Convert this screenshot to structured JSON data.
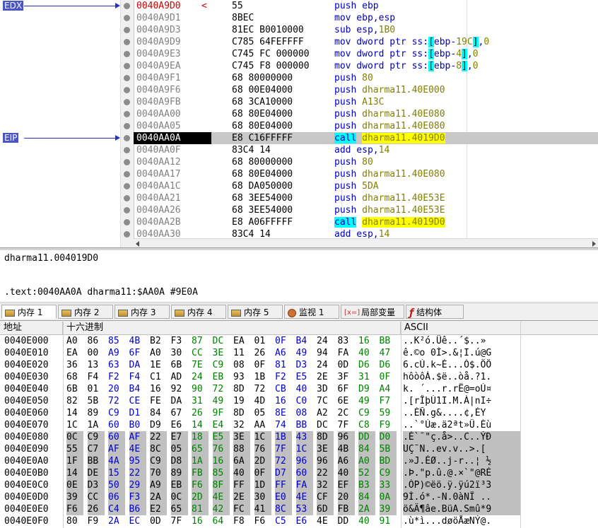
{
  "registers": [
    {
      "name": "EDX",
      "row": 0
    },
    {
      "name": "EIP",
      "row": 11
    }
  ],
  "disasm": {
    "rows": [
      {
        "addr": "0040A9D0",
        "mark": "<",
        "bytes": "55",
        "parts": [
          [
            "mn",
            "push "
          ],
          [
            "op",
            "ebp"
          ]
        ]
      },
      {
        "addr": "0040A9D1",
        "mark": "",
        "bytes": "8BEC",
        "parts": [
          [
            "op",
            "mov ebp,esp"
          ]
        ]
      },
      {
        "addr": "0040A9D3",
        "mark": "",
        "bytes": "81EC B0010000",
        "parts": [
          [
            "op",
            "sub esp,"
          ],
          [
            "num",
            "1B0"
          ]
        ]
      },
      {
        "addr": "0040A9D9",
        "mark": "",
        "bytes": "C785 64FEFFFF",
        "parts": [
          [
            "op",
            "mov dword ptr "
          ],
          [
            "seg",
            "ss:"
          ],
          [
            "br",
            "["
          ],
          [
            "op",
            "ebp-"
          ],
          [
            "num",
            "19C"
          ],
          [
            "br",
            "]"
          ],
          [
            "op",
            ","
          ],
          [
            "num",
            "0"
          ]
        ]
      },
      {
        "addr": "0040A9E3",
        "mark": "",
        "bytes": "C745 FC 000000",
        "parts": [
          [
            "op",
            "mov dword ptr "
          ],
          [
            "seg",
            "ss:"
          ],
          [
            "br",
            "["
          ],
          [
            "op",
            "ebp-"
          ],
          [
            "num",
            "4"
          ],
          [
            "br",
            "]"
          ],
          [
            "op",
            ","
          ],
          [
            "num",
            "0"
          ]
        ]
      },
      {
        "addr": "0040A9EA",
        "mark": "",
        "bytes": "C745 F8 000000",
        "parts": [
          [
            "op",
            "mov dword ptr "
          ],
          [
            "seg",
            "ss:"
          ],
          [
            "br",
            "["
          ],
          [
            "op",
            "ebp-"
          ],
          [
            "num",
            "8"
          ],
          [
            "br",
            "]"
          ],
          [
            "op",
            ","
          ],
          [
            "num",
            "0"
          ]
        ]
      },
      {
        "addr": "0040A9F1",
        "mark": "",
        "bytes": "68 80000000",
        "parts": [
          [
            "mn",
            "push "
          ],
          [
            "num",
            "80"
          ]
        ]
      },
      {
        "addr": "0040A9F6",
        "mark": "",
        "bytes": "68 00E04000",
        "parts": [
          [
            "mn",
            "push "
          ],
          [
            "num",
            "dharma11.40E000"
          ]
        ]
      },
      {
        "addr": "0040A9FB",
        "mark": "",
        "bytes": "68 3CA10000",
        "parts": [
          [
            "mn",
            "push "
          ],
          [
            "num",
            "A13C"
          ]
        ]
      },
      {
        "addr": "0040AA00",
        "mark": "",
        "bytes": "68 80E04000",
        "parts": [
          [
            "mn",
            "push "
          ],
          [
            "num",
            "dharma11.40E080"
          ]
        ]
      },
      {
        "addr": "0040AA05",
        "mark": "",
        "bytes": "68 80E04000",
        "parts": [
          [
            "mn",
            "push "
          ],
          [
            "num",
            "dharma11.40E080"
          ]
        ]
      },
      {
        "addr": "0040AA0A",
        "mark": "",
        "bytes": "E8 C16FFFFF",
        "current": true,
        "parts": [
          [
            "call",
            "call"
          ],
          [
            "op",
            " "
          ],
          [
            "tgt",
            "dharma11.4019D0"
          ]
        ]
      },
      {
        "addr": "0040AA0F",
        "mark": "",
        "bytes": "83C4 14",
        "parts": [
          [
            "op",
            "add esp,"
          ],
          [
            "num",
            "14"
          ]
        ]
      },
      {
        "addr": "0040AA12",
        "mark": "",
        "bytes": "68 80000000",
        "parts": [
          [
            "mn",
            "push "
          ],
          [
            "num",
            "80"
          ]
        ]
      },
      {
        "addr": "0040AA17",
        "mark": "",
        "bytes": "68 80E04000",
        "parts": [
          [
            "mn",
            "push "
          ],
          [
            "num",
            "dharma11.40E080"
          ]
        ]
      },
      {
        "addr": "0040AA1C",
        "mark": "",
        "bytes": "68 DA050000",
        "parts": [
          [
            "mn",
            "push "
          ],
          [
            "num",
            "5DA"
          ]
        ]
      },
      {
        "addr": "0040AA21",
        "mark": "",
        "bytes": "68 3EE54000",
        "parts": [
          [
            "mn",
            "push "
          ],
          [
            "num",
            "dharma11.40E53E"
          ]
        ]
      },
      {
        "addr": "0040AA26",
        "mark": "",
        "bytes": "68 3EE54000",
        "parts": [
          [
            "mn",
            "push "
          ],
          [
            "num",
            "dharma11.40E53E"
          ]
        ]
      },
      {
        "addr": "0040AA2B",
        "mark": "",
        "bytes": "E8 A06FFFFF",
        "parts": [
          [
            "call",
            "call"
          ],
          [
            "op",
            " "
          ],
          [
            "tgt",
            "dharma11.4019D0"
          ]
        ]
      },
      {
        "addr": "0040AA30",
        "mark": "",
        "bytes": "83C4 14",
        "parts": [
          [
            "op",
            "add esp,"
          ],
          [
            "num",
            "14"
          ]
        ]
      }
    ]
  },
  "info": {
    "line1": "dharma11.004019D0",
    "line2": ".text:0040AA0A dharma11:$AA0A #9E0A"
  },
  "tabs": [
    {
      "label": "内存 1",
      "icon": "memory-icon",
      "active": true
    },
    {
      "label": "内存 2",
      "icon": "memory-icon"
    },
    {
      "label": "内存 3",
      "icon": "memory-icon"
    },
    {
      "label": "内存 4",
      "icon": "memory-icon"
    },
    {
      "label": "内存 5",
      "icon": "memory-icon"
    },
    {
      "label": "监视 1",
      "icon": "watch-icon"
    },
    {
      "label": "局部变量",
      "icon": "locals-icon",
      "icon_text": "[x=]"
    },
    {
      "label": "结构体",
      "icon": "struct-icon"
    }
  ],
  "hex": {
    "headers": {
      "address": "地址",
      "hex": "十六进制",
      "ascii": "ASCII"
    },
    "rows": [
      {
        "addr": "0040E000",
        "bytes": [
          "A0",
          "86",
          "85",
          "4B",
          "B2",
          "F3",
          "87",
          "DC",
          "EA",
          "01",
          "0F",
          "B4",
          "24",
          "83",
          "16",
          "BB"
        ],
        "ascii": "..K²ó.Üê..´$..»"
      },
      {
        "addr": "0040E010",
        "bytes": [
          "EA",
          "00",
          "A9",
          "6F",
          "A0",
          "30",
          "CC",
          "3E",
          "11",
          "26",
          "A6",
          "49",
          "94",
          "FA",
          "40",
          "47"
        ],
        "ascii": "ê.©o 0Ì>.&¦I.ú@G"
      },
      {
        "addr": "0040E020",
        "bytes": [
          "36",
          "13",
          "63",
          "DA",
          "1E",
          "6B",
          "7E",
          "C9",
          "08",
          "0F",
          "81",
          "D3",
          "24",
          "0D",
          "D6",
          "D6"
        ],
        "ascii": "6.cÚ.k~É...Ó$.ÖÖ"
      },
      {
        "addr": "0040E030",
        "bytes": [
          "68",
          "F4",
          "F2",
          "F4",
          "C1",
          "AD",
          "24",
          "EB",
          "93",
          "1B",
          "F2",
          "E5",
          "2E",
          "3F",
          "31",
          "0F"
        ],
        "ascii": "hôòôÁ.$ë..òå.?1."
      },
      {
        "addr": "0040E040",
        "bytes": [
          "6B",
          "01",
          "20",
          "B4",
          "16",
          "92",
          "90",
          "72",
          "8D",
          "72",
          "CB",
          "40",
          "3D",
          "6F",
          "D9",
          "A4"
        ],
        "ascii": "k. ´...r.rË@=oÙ¤"
      },
      {
        "addr": "0040E050",
        "bytes": [
          "82",
          "5B",
          "72",
          "CE",
          "FE",
          "DA",
          "31",
          "49",
          "19",
          "4D",
          "16",
          "C0",
          "7C",
          "6E",
          "49",
          "F7"
        ],
        "ascii": ".[rÎþÚ1I.M.À|nI÷"
      },
      {
        "addr": "0040E060",
        "bytes": [
          "14",
          "89",
          "C9",
          "D1",
          "84",
          "67",
          "26",
          "9F",
          "8D",
          "05",
          "8E",
          "08",
          "A2",
          "2C",
          "C9",
          "59"
        ],
        "ascii": "..ÉÑ.g&....¢,ÉY"
      },
      {
        "addr": "0040E070",
        "bytes": [
          "1C",
          "1A",
          "60",
          "B0",
          "D9",
          "E6",
          "14",
          "E4",
          "32",
          "AA",
          "74",
          "BB",
          "DC",
          "7F",
          "C8",
          "F9"
        ],
        "ascii": "..`°Ùæ.ä2ªt»Ü.Èù"
      },
      {
        "addr": "0040E080",
        "bytes": [
          "0C",
          "C9",
          "60",
          "AF",
          "22",
          "E7",
          "18",
          "E5",
          "3E",
          "1C",
          "1B",
          "43",
          "8D",
          "96",
          "DD",
          "D0"
        ],
        "ascii": ".É`¯\"ç.å>..C..ÝÐ",
        "sel": true
      },
      {
        "addr": "0040E090",
        "bytes": [
          "55",
          "C7",
          "AF",
          "4E",
          "8C",
          "05",
          "65",
          "76",
          "88",
          "76",
          "7F",
          "1C",
          "3E",
          "4B",
          "84",
          "5B"
        ],
        "ascii": "UÇ¯N..ev.v..>.[",
        "sel": true
      },
      {
        "addr": "0040E0A0",
        "bytes": [
          "1F",
          "BB",
          "4A",
          "95",
          "C9",
          "D8",
          "1A",
          "16",
          "6A",
          "2D",
          "72",
          "96",
          "96",
          "A6",
          "A0",
          "BD"
        ],
        "ascii": ".»J.ÉØ..j-r..¦ ½",
        "sel": true
      },
      {
        "addr": "0040E0B0",
        "bytes": [
          "14",
          "DE",
          "15",
          "22",
          "70",
          "89",
          "FB",
          "85",
          "40",
          "0F",
          "D7",
          "60",
          "22",
          "40",
          "52",
          "C9"
        ],
        "ascii": ".Þ.\"p.û.@.×`\"@RÉ",
        "sel": true
      },
      {
        "addr": "0040E0C0",
        "bytes": [
          "0E",
          "D3",
          "50",
          "29",
          "A9",
          "EB",
          "F6",
          "8F",
          "FF",
          "1D",
          "FF",
          "FA",
          "32",
          "EF",
          "B3",
          "33"
        ],
        "ascii": ".ÓP)©ëö.ÿ.ÿú2ï³3",
        "sel": true
      },
      {
        "addr": "0040E0D0",
        "bytes": [
          "39",
          "CC",
          "06",
          "F3",
          "2A",
          "0C",
          "2D",
          "4E",
          "2E",
          "30",
          "E0",
          "4E",
          "CF",
          "20",
          "84",
          "0A"
        ],
        "ascii": "9Ì.ó*.-N.0àNÏ ..",
        "sel": true
      },
      {
        "addr": "0040E0E0",
        "bytes": [
          "F6",
          "26",
          "C4",
          "B6",
          "E2",
          "65",
          "81",
          "42",
          "FC",
          "41",
          "8C",
          "53",
          "6D",
          "FB",
          "2A",
          "39"
        ],
        "ascii": "ö&Ä¶âe.BüA.Smû*9",
        "sel": true
      },
      {
        "addr": "0040E0F0",
        "bytes": [
          "80",
          "F9",
          "2A",
          "EC",
          "0D",
          "7F",
          "16",
          "64",
          "F8",
          "F6",
          "C5",
          "E6",
          "4E",
          "DD",
          "40",
          "91"
        ],
        "ascii": ".ù*ì...døöÅæNÝ@."
      }
    ]
  },
  "colors": {
    "hex_byte_blue": "#0000c8",
    "hex_byte_green": "#008000",
    "hex_byte_black": "#000000",
    "selection": "#c0c0c0",
    "current_line": "#c8c8c8",
    "register_label": "#4a55c8"
  }
}
